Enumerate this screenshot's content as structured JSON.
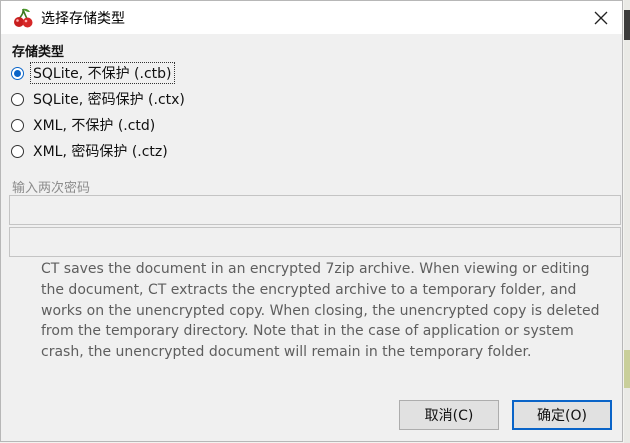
{
  "window": {
    "title": "选择存储类型",
    "close_label": "Close"
  },
  "storage": {
    "label": "存储类型",
    "options": [
      {
        "label": "SQLite, 不保护 (.ctb)",
        "checked": true
      },
      {
        "label": "SQLite, 密码保护 (.ctx)",
        "checked": false
      },
      {
        "label": "XML, 不保护 (.ctd)",
        "checked": false
      },
      {
        "label": "XML, 密码保护 (.ctz)",
        "checked": false
      }
    ]
  },
  "password": {
    "label": "输入两次密码",
    "field1_value": "",
    "field2_value": ""
  },
  "description": "CT saves the document in an encrypted 7zip archive. When viewing or editing the document, CT extracts the encrypted archive to a temporary folder, and works on the unencrypted copy. When closing, the unencrypted copy is deleted from the temporary directory. Note that in the case of application or system crash, the unencrypted document will remain in the temporary folder.",
  "buttons": {
    "cancel": "取消(C)",
    "ok": "确定(O)"
  },
  "colors": {
    "accent": "#0a64c8",
    "disabled_text": "#8c8c8c"
  }
}
